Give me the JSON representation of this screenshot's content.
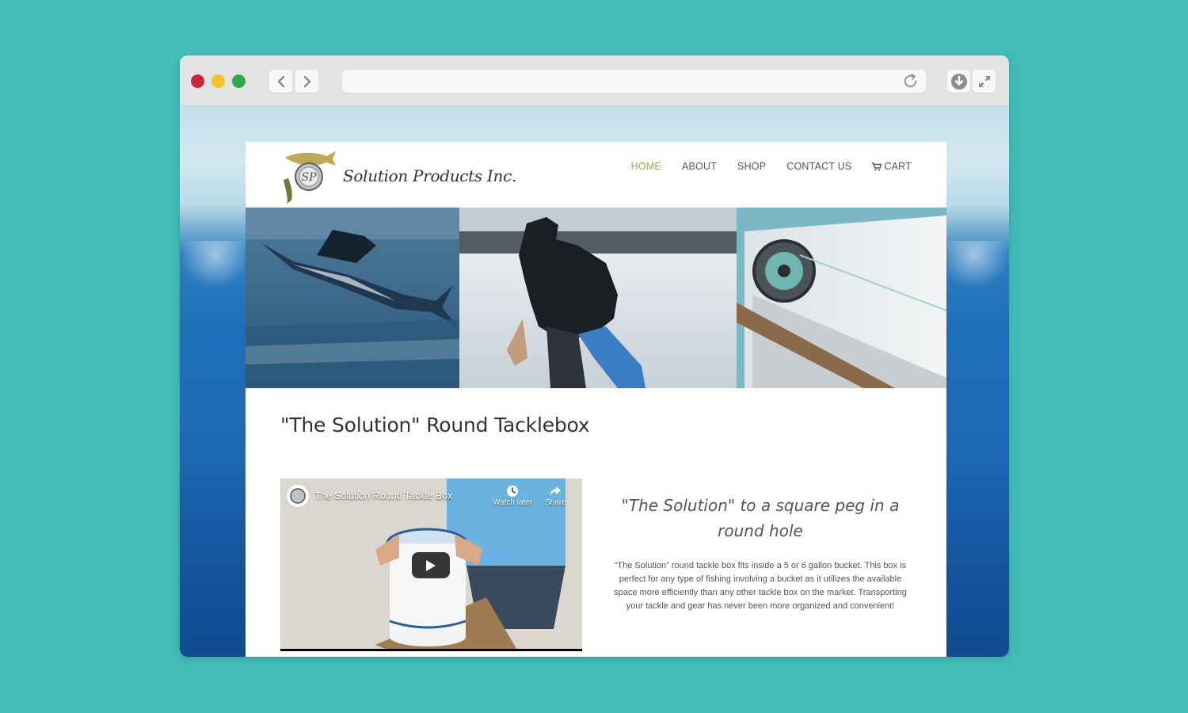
{
  "site": {
    "brand_name": "Solution Products Inc.",
    "logo_initials": "SP",
    "nav": [
      {
        "label": "HOME",
        "active": true
      },
      {
        "label": "ABOUT",
        "active": false
      },
      {
        "label": "SHOP",
        "active": false
      },
      {
        "label": "CONTACT US",
        "active": false
      },
      {
        "label": "CART",
        "active": false
      }
    ]
  },
  "main": {
    "title": "\"The Solution\" Round Tacklebox",
    "video": {
      "title": "The Solution Round Tackle Box",
      "watch_later": "Watch later",
      "share": "Share"
    },
    "tagline": "\"The Solution\" to a square peg in a round hole",
    "body": "“The Solution” round tackle box fits inside a 5 or 6 gallon bucket. This box is perfect for any type of fishing involving a bucket as it utilizes the available space more efficiently than any other tackle box on the market. Transporting your tackle and gear has never been more organized and convenient!"
  },
  "colors": {
    "background": "#41bcb8",
    "nav_active": "#8bb43d",
    "close_dot": "#c9283a",
    "minimize_dot": "#f5c12a",
    "zoom_dot": "#2fa84a"
  }
}
